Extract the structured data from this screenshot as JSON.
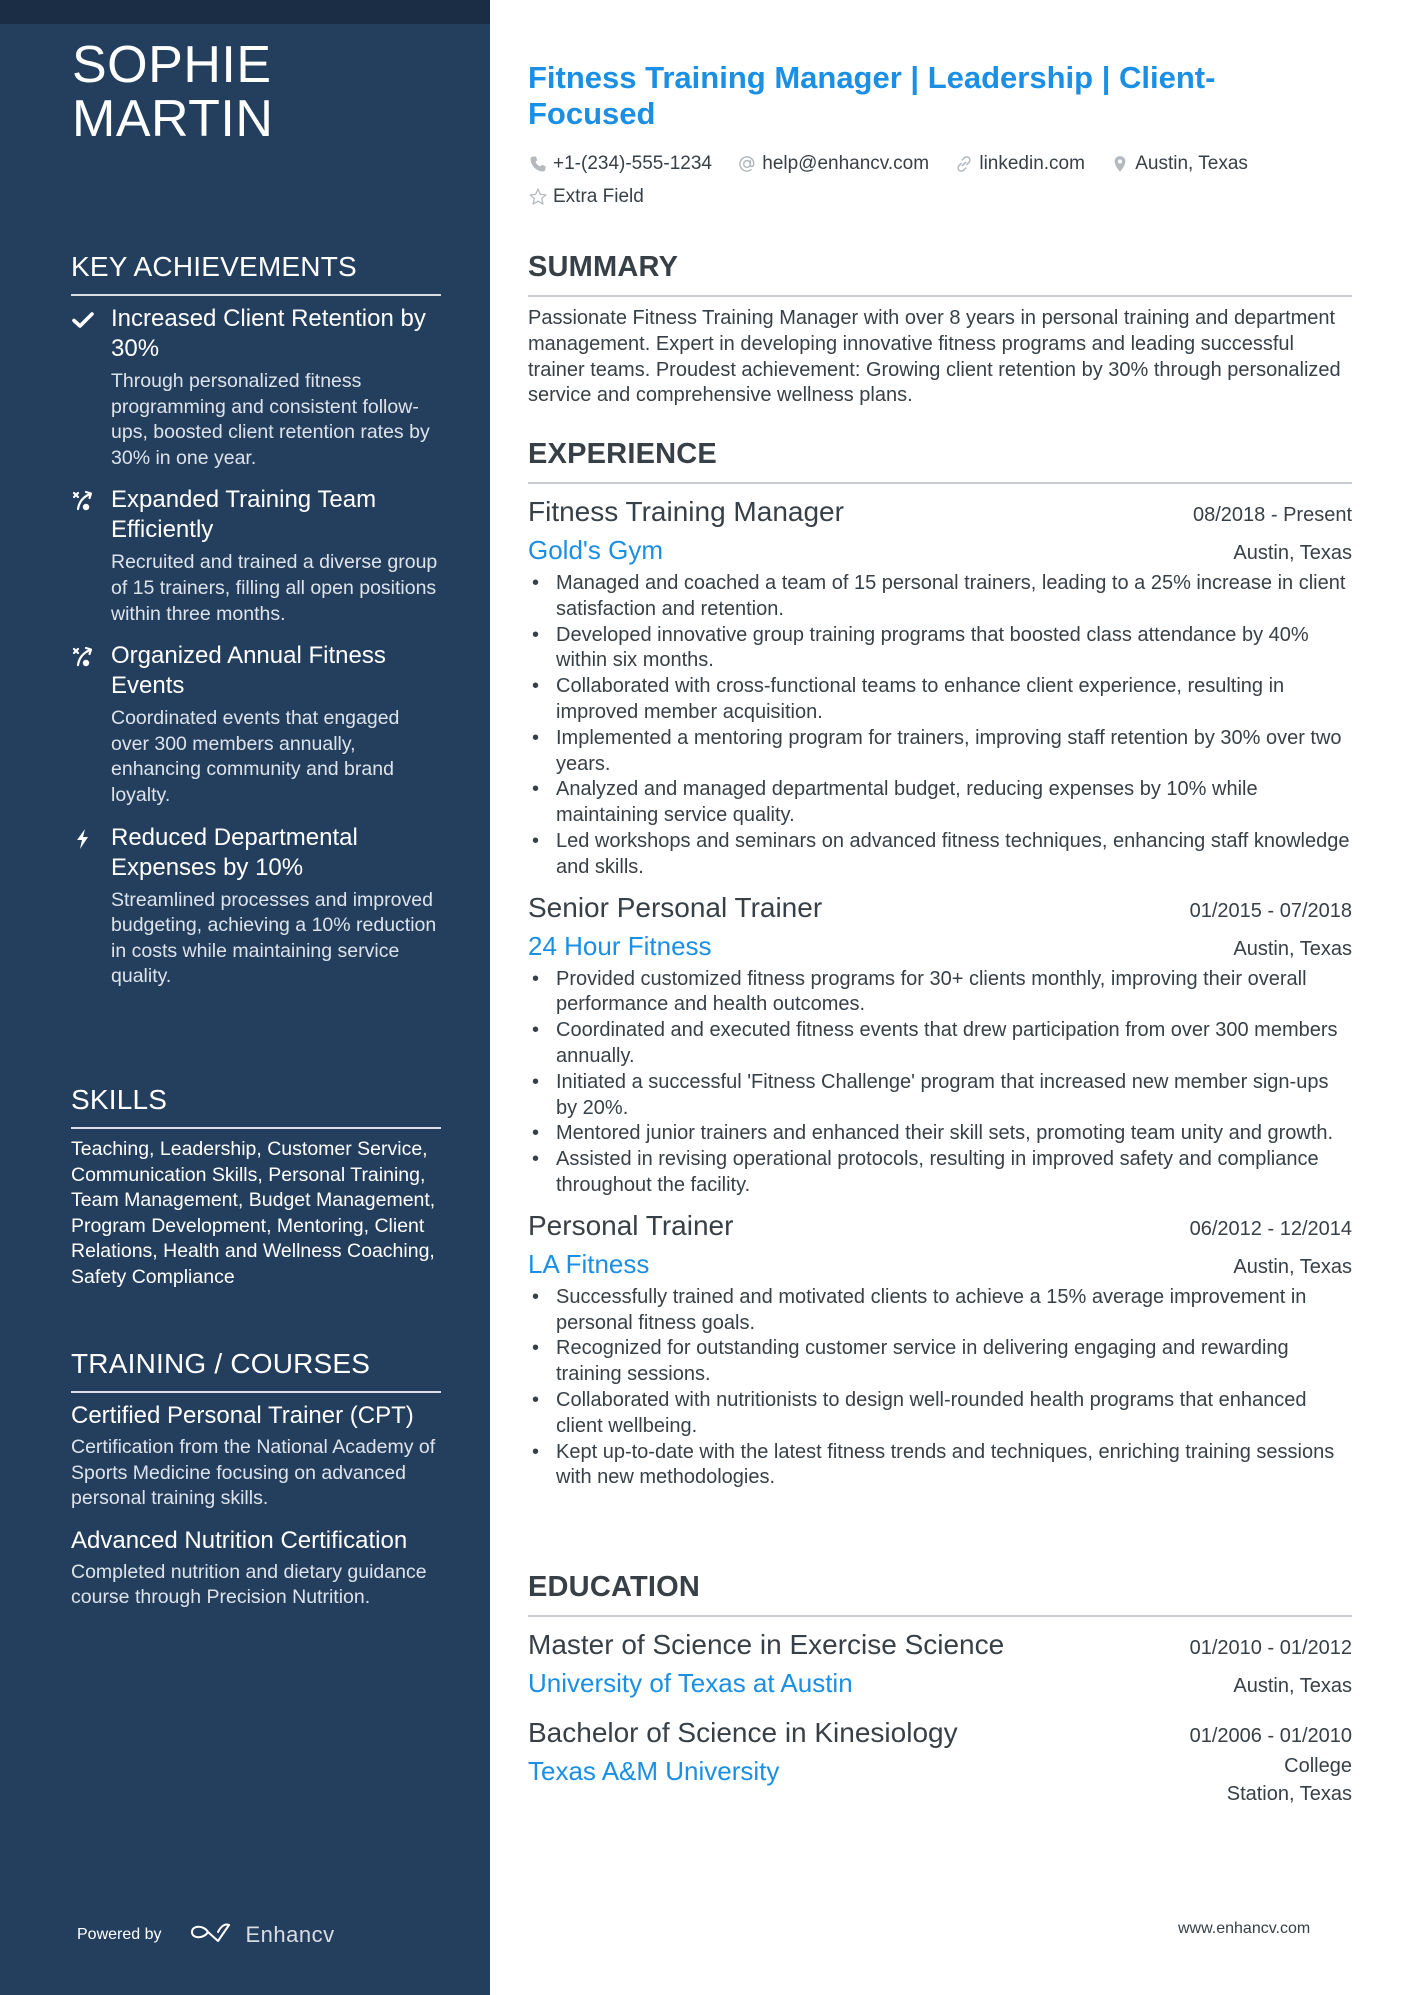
{
  "sidebar": {
    "name": "SOPHIE MARTIN",
    "achievements": {
      "heading": "KEY ACHIEVEMENTS",
      "items": [
        {
          "icon": "check-icon",
          "title": "Increased Client Retention by 30%",
          "description": "Through personalized fitness programming and consistent follow-ups, boosted client retention rates by 30% in one year."
        },
        {
          "icon": "strategy-icon",
          "title": "Expanded Training Team Efficiently",
          "description": "Recruited and trained a diverse group of 15 trainers, filling all open positions within three months."
        },
        {
          "icon": "strategy-icon",
          "title": "Organized Annual Fitness Events",
          "description": "Coordinated events that engaged over 300 members annually, enhancing community and brand loyalty."
        },
        {
          "icon": "lightning-icon",
          "title": "Reduced Departmental Expenses by 10%",
          "description": "Streamlined processes and improved budgeting, achieving a 10% reduction in costs while maintaining service quality."
        }
      ]
    },
    "skills": {
      "heading": "SKILLS",
      "text": "Teaching, Leadership, Customer Service, Communication Skills, Personal Training, Team Management, Budget Management, Program Development, Mentoring, Client Relations, Health and Wellness Coaching, Safety Compliance"
    },
    "training": {
      "heading": "TRAINING / COURSES",
      "items": [
        {
          "title": "Certified Personal Trainer (CPT)",
          "description": "Certification from the National Academy of Sports Medicine focusing on advanced personal training skills."
        },
        {
          "title": "Advanced Nutrition Certification",
          "description": "Completed nutrition and dietary guidance course through Precision Nutrition."
        }
      ]
    },
    "footer": {
      "powered_by": "Powered by",
      "brand": "Enhancv"
    }
  },
  "header": {
    "title": "Fitness Training Manager | Leadership | Client-Focused",
    "contacts": [
      {
        "icon": "phone-icon",
        "text": "+1-(234)-555-1234"
      },
      {
        "icon": "at-icon",
        "text": "help@enhancv.com"
      },
      {
        "icon": "link-icon",
        "text": "linkedin.com"
      },
      {
        "icon": "location-icon",
        "text": "Austin, Texas"
      },
      {
        "icon": "star-icon",
        "text": "Extra Field"
      }
    ]
  },
  "summary": {
    "heading": "SUMMARY",
    "text": "Passionate Fitness Training Manager with over 8 years in personal training and department management. Expert in developing innovative fitness programs and leading successful trainer teams. Proudest achievement: Growing client retention by 30% through personalized service and comprehensive wellness plans."
  },
  "experience": {
    "heading": "EXPERIENCE",
    "jobs": [
      {
        "title": "Fitness Training Manager",
        "dates": "08/2018 - Present",
        "company": "Gold's Gym",
        "location": "Austin, Texas",
        "bullets": [
          "Managed and coached a team of 15 personal trainers, leading to a 25% increase in client satisfaction and retention.",
          "Developed innovative group training programs that boosted class attendance by 40% within six months.",
          "Collaborated with cross-functional teams to enhance client experience, resulting in improved member acquisition.",
          "Implemented a mentoring program for trainers, improving staff retention by 30% over two years.",
          "Analyzed and managed departmental budget, reducing expenses by 10% while maintaining service quality.",
          "Led workshops and seminars on advanced fitness techniques, enhancing staff knowledge and skills."
        ]
      },
      {
        "title": "Senior Personal Trainer",
        "dates": "01/2015 - 07/2018",
        "company": "24 Hour Fitness",
        "location": "Austin, Texas",
        "bullets": [
          "Provided customized fitness programs for 30+ clients monthly, improving their overall performance and health outcomes.",
          "Coordinated and executed fitness events that drew participation from over 300 members annually.",
          "Initiated a successful 'Fitness Challenge' program that increased new member sign-ups by 20%.",
          "Mentored junior trainers and enhanced their skill sets, promoting team unity and growth.",
          "Assisted in revising operational protocols, resulting in improved safety and compliance throughout the facility."
        ]
      },
      {
        "title": "Personal Trainer",
        "dates": "06/2012 - 12/2014",
        "company": "LA Fitness",
        "location": "Austin, Texas",
        "bullets": [
          "Successfully trained and motivated clients to achieve a 15% average improvement in personal fitness goals.",
          "Recognized for outstanding customer service in delivering engaging and rewarding training sessions.",
          "Collaborated with nutritionists to design well-rounded health programs that enhanced client wellbeing.",
          "Kept up-to-date with the latest fitness trends and techniques, enriching training sessions with new methodologies."
        ]
      }
    ]
  },
  "education": {
    "heading": "EDUCATION",
    "items": [
      {
        "degree": "Master of Science in Exercise Science",
        "dates": "01/2010 - 01/2012",
        "school": "University of Texas at Austin",
        "location": "Austin, Texas"
      },
      {
        "degree": "Bachelor of Science in Kinesiology",
        "dates": "01/2006 - 01/2010",
        "school": "Texas A&M University",
        "location": "College Station, Texas"
      }
    ]
  },
  "footer": {
    "url": "www.enhancv.com"
  },
  "colors": {
    "sidebar": "#243f5e",
    "top_strip": "#1b2d45",
    "accent": "#1a8fe3",
    "text": "#384047"
  }
}
